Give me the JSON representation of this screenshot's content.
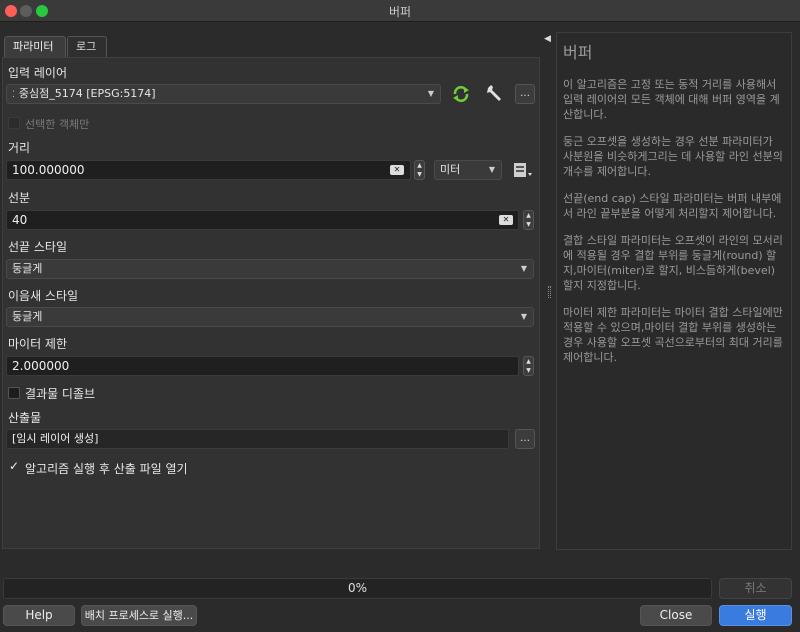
{
  "window": {
    "title": "버퍼"
  },
  "tabs": [
    {
      "label": "파라미터"
    },
    {
      "label": "로그"
    }
  ],
  "params": {
    "input_layer": {
      "label": "입력 레이어",
      "value": "중심점_5174 [EPSG:5174]"
    },
    "selected_only": {
      "label": "선택한 객체만",
      "checked": false
    },
    "distance": {
      "label": "거리",
      "value": "100.000000",
      "unit": "미터"
    },
    "segments": {
      "label": "선분",
      "value": "40"
    },
    "end_cap": {
      "label": "선끝 스타일",
      "value": "둥글게"
    },
    "join_style": {
      "label": "이음새 스타일",
      "value": "둥글게"
    },
    "miter": {
      "label": "마이터 제한",
      "value": "2.000000"
    },
    "dissolve": {
      "label": "결과물 디졸브",
      "checked": false
    },
    "output": {
      "label": "산출물",
      "value": "[임시 레이어 생성]"
    },
    "open_after": {
      "label": "알고리즘 실행 후 산출 파일 열기",
      "checked": true
    }
  },
  "help": {
    "title": "버퍼",
    "p1": "이 알고리즘은 고정 또는 동적 거리를 사용해서 입력 레이어의 모든 객체에 대해 버퍼 영역을 계산합니다.",
    "p2": "둥근 오프셋을 생성하는 경우 선분 파라미터가 사분원을 비슷하게그리는 데 사용할 라인 선분의 개수를 제어합니다.",
    "p3": "선끝(end cap) 스타일 파라미터는 버퍼 내부에서 라인 끝부분을 어떻게 처리할지 제어합니다.",
    "p4": "결합 스타일 파라미터는 오프셋이 라인의 모서리에 적용될 경우 결합 부위를 둥글게(round) 할지,마이터(miter)로 할지, 비스듬하게(bevel) 할지 지정합니다.",
    "p5": "마이터 제한 파라미터는 마이터 결합 스타일에만 적용할 수 있으며,마이터 결합 부위를 생성하는 경우 사용할 오프셋 곡선으로부터의 최대 거리를 제어합니다."
  },
  "footer": {
    "progress": "0%",
    "progress_value": 0,
    "cancel": "취소",
    "help": "Help",
    "batch": "배치 프로세스로 실행...",
    "close": "Close",
    "run": "실행"
  },
  "colors": {
    "accent": "#3a7be0",
    "reload_icon": "#6fcf3a"
  }
}
